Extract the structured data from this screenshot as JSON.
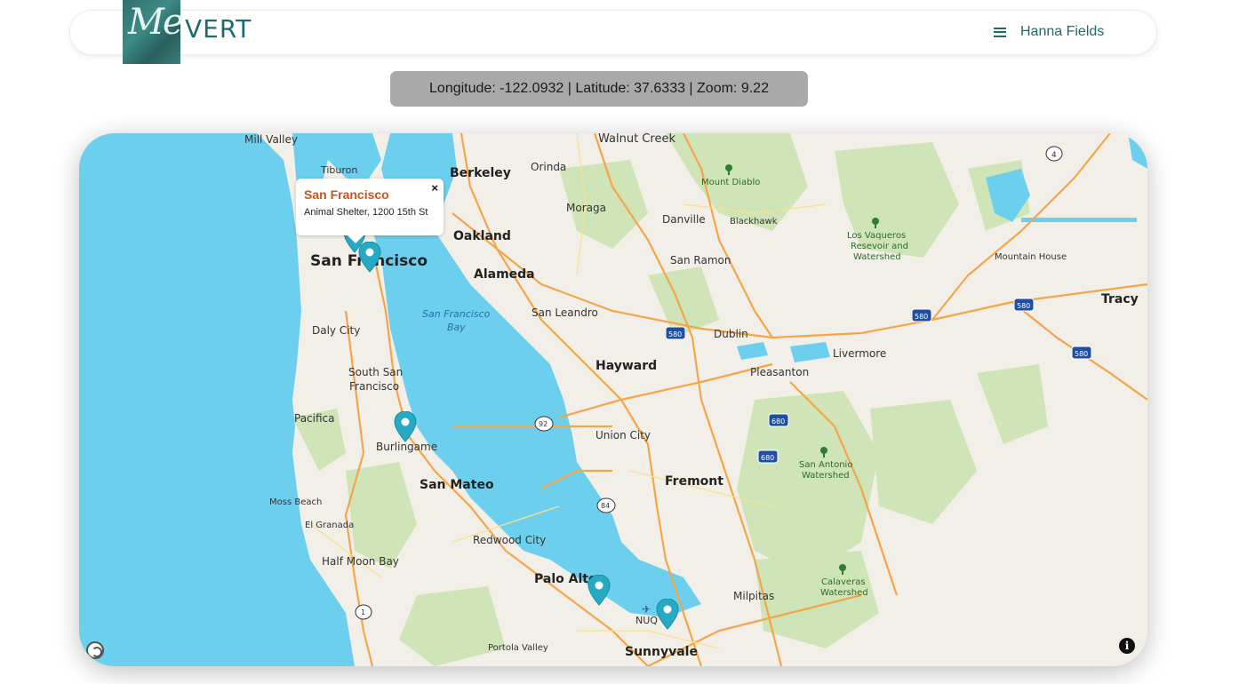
{
  "header": {
    "logo_me": "Me",
    "logo_vert": "VERT",
    "menu_label": "Hanna Fields",
    "menu_icon": "hamburger-icon"
  },
  "coords": {
    "text": "Longitude: -122.0932 | Latitude: 37.6333 | Zoom: 9.22"
  },
  "map": {
    "colors": {
      "water": "#6ccfee",
      "land": "#f2efe8",
      "park": "#c9e2b3",
      "road": "#f4a54a",
      "pin": "#26a9c2"
    },
    "places": {
      "mill_valley": "Mill Valley",
      "walnut_creek": "Walnut Creek",
      "tiburon": "Tiburon",
      "berkeley": "Berkeley",
      "orinda": "Orinda",
      "mount_diablo": "Mount Diablo",
      "moraga": "Moraga",
      "danville": "Danville",
      "blackhawk": "Blackhawk",
      "oakland": "Oakland",
      "los_vaqueros_1": "Los Vaqueros",
      "los_vaqueros_2": "Resevoir and",
      "los_vaqueros_3": "Watershed",
      "san_francisco": "San Francisco",
      "alameda": "Alameda",
      "san_ramon": "San Ramon",
      "mountain_house": "Mountain House",
      "tracy": "Tracy",
      "sf_bay_1": "San Francisco",
      "sf_bay_2": "Bay",
      "san_leandro": "San Leandro",
      "daly_city": "Daly City",
      "dublin": "Dublin",
      "livermore": "Livermore",
      "hayward": "Hayward",
      "pleasanton": "Pleasanton",
      "south_sf_1": "South San",
      "south_sf_2": "Francisco",
      "pacifica": "Pacifica",
      "union_city": "Union City",
      "burlingame": "Burlingame",
      "fremont": "Fremont",
      "san_antonio_1": "San Antonio",
      "san_antonio_2": "Watershed",
      "san_mateo": "San Mateo",
      "moss_beach": "Moss Beach",
      "el_granada": "El Granada",
      "redwood_city": "Redwood City",
      "half_moon_bay": "Half Moon Bay",
      "calaveras_1": "Calaveras",
      "calaveras_2": "Watershed",
      "palo_alto": "Palo Alto",
      "milpitas": "Milpitas",
      "nuq": "NUQ",
      "portola_valley": "Portola Valley",
      "sunnyvale": "Sunnyvale"
    },
    "shields": {
      "hwy4": "4",
      "i580_a": "580",
      "i580_b": "580",
      "i580_c": "580",
      "i580_d": "580",
      "i680_a": "680",
      "i680_b": "680",
      "hwy92": "92",
      "hwy84": "84",
      "hwy1": "1"
    },
    "popup": {
      "title": "San Francisco",
      "subtitle": "Animal Shelter, 1200 15th St",
      "close": "×"
    },
    "info_button": "i"
  }
}
